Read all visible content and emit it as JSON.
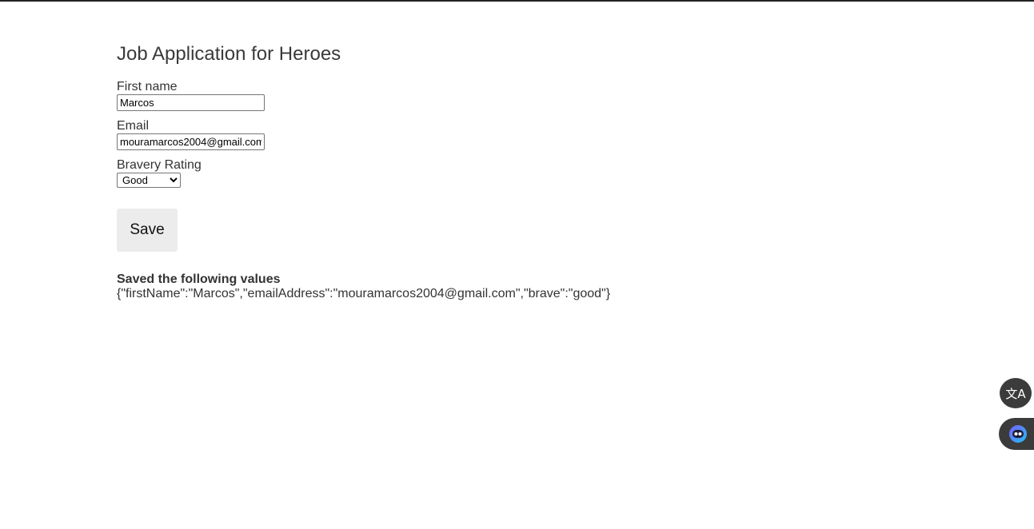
{
  "page": {
    "title": "Job Application for Heroes"
  },
  "form": {
    "first_name": {
      "label": "First name",
      "value": "Marcos"
    },
    "email": {
      "label": "Email",
      "value": "mouramarcos2004@gmail.com"
    },
    "bravery": {
      "label": "Bravery Rating",
      "selected": "Good"
    },
    "save_label": "Save"
  },
  "result": {
    "heading": "Saved the following values",
    "json": "{\"firstName\":\"Marcos\",\"emailAddress\":\"mouramarcos2004@gmail.com\",\"brave\":\"good\"}"
  },
  "floating": {
    "translate_icon": "translate-icon",
    "assistant_icon": "assistant-icon",
    "translate_glyph": "文A"
  },
  "colors": {
    "accent_gradient": [
      "#7b5cff",
      "#22c1ee"
    ],
    "floating_bg": "#3b3b3b",
    "button_bg": "#ececec"
  }
}
